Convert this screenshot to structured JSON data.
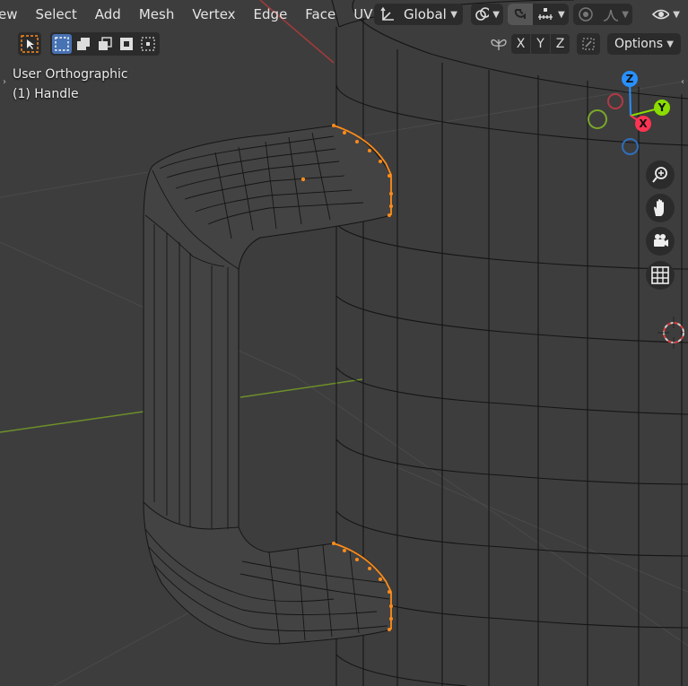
{
  "header": {
    "menu": [
      {
        "label": "ew"
      },
      {
        "label": "Select"
      },
      {
        "label": "Add"
      },
      {
        "label": "Mesh"
      },
      {
        "label": "Vertex"
      },
      {
        "label": "Edge"
      },
      {
        "label": "Face"
      },
      {
        "label": "UV"
      }
    ],
    "transform_orientation": "Global",
    "options_label": "Options"
  },
  "toolbar": {
    "mirror_axes": [
      "X",
      "Y",
      "Z"
    ]
  },
  "viewport": {
    "view_name": "User Orthographic",
    "object_name": "(1) Handle"
  },
  "gizmo": {
    "z_label": "Z",
    "y_label": "Y",
    "x_label": "X"
  },
  "colors": {
    "background": "#3d3d3d",
    "wire": "#111111",
    "selected": "#ff8c1a",
    "axis_x": "#ff3352",
    "axis_y": "#8bdc00",
    "axis_z": "#2890ff",
    "accent": "#4772b3"
  }
}
